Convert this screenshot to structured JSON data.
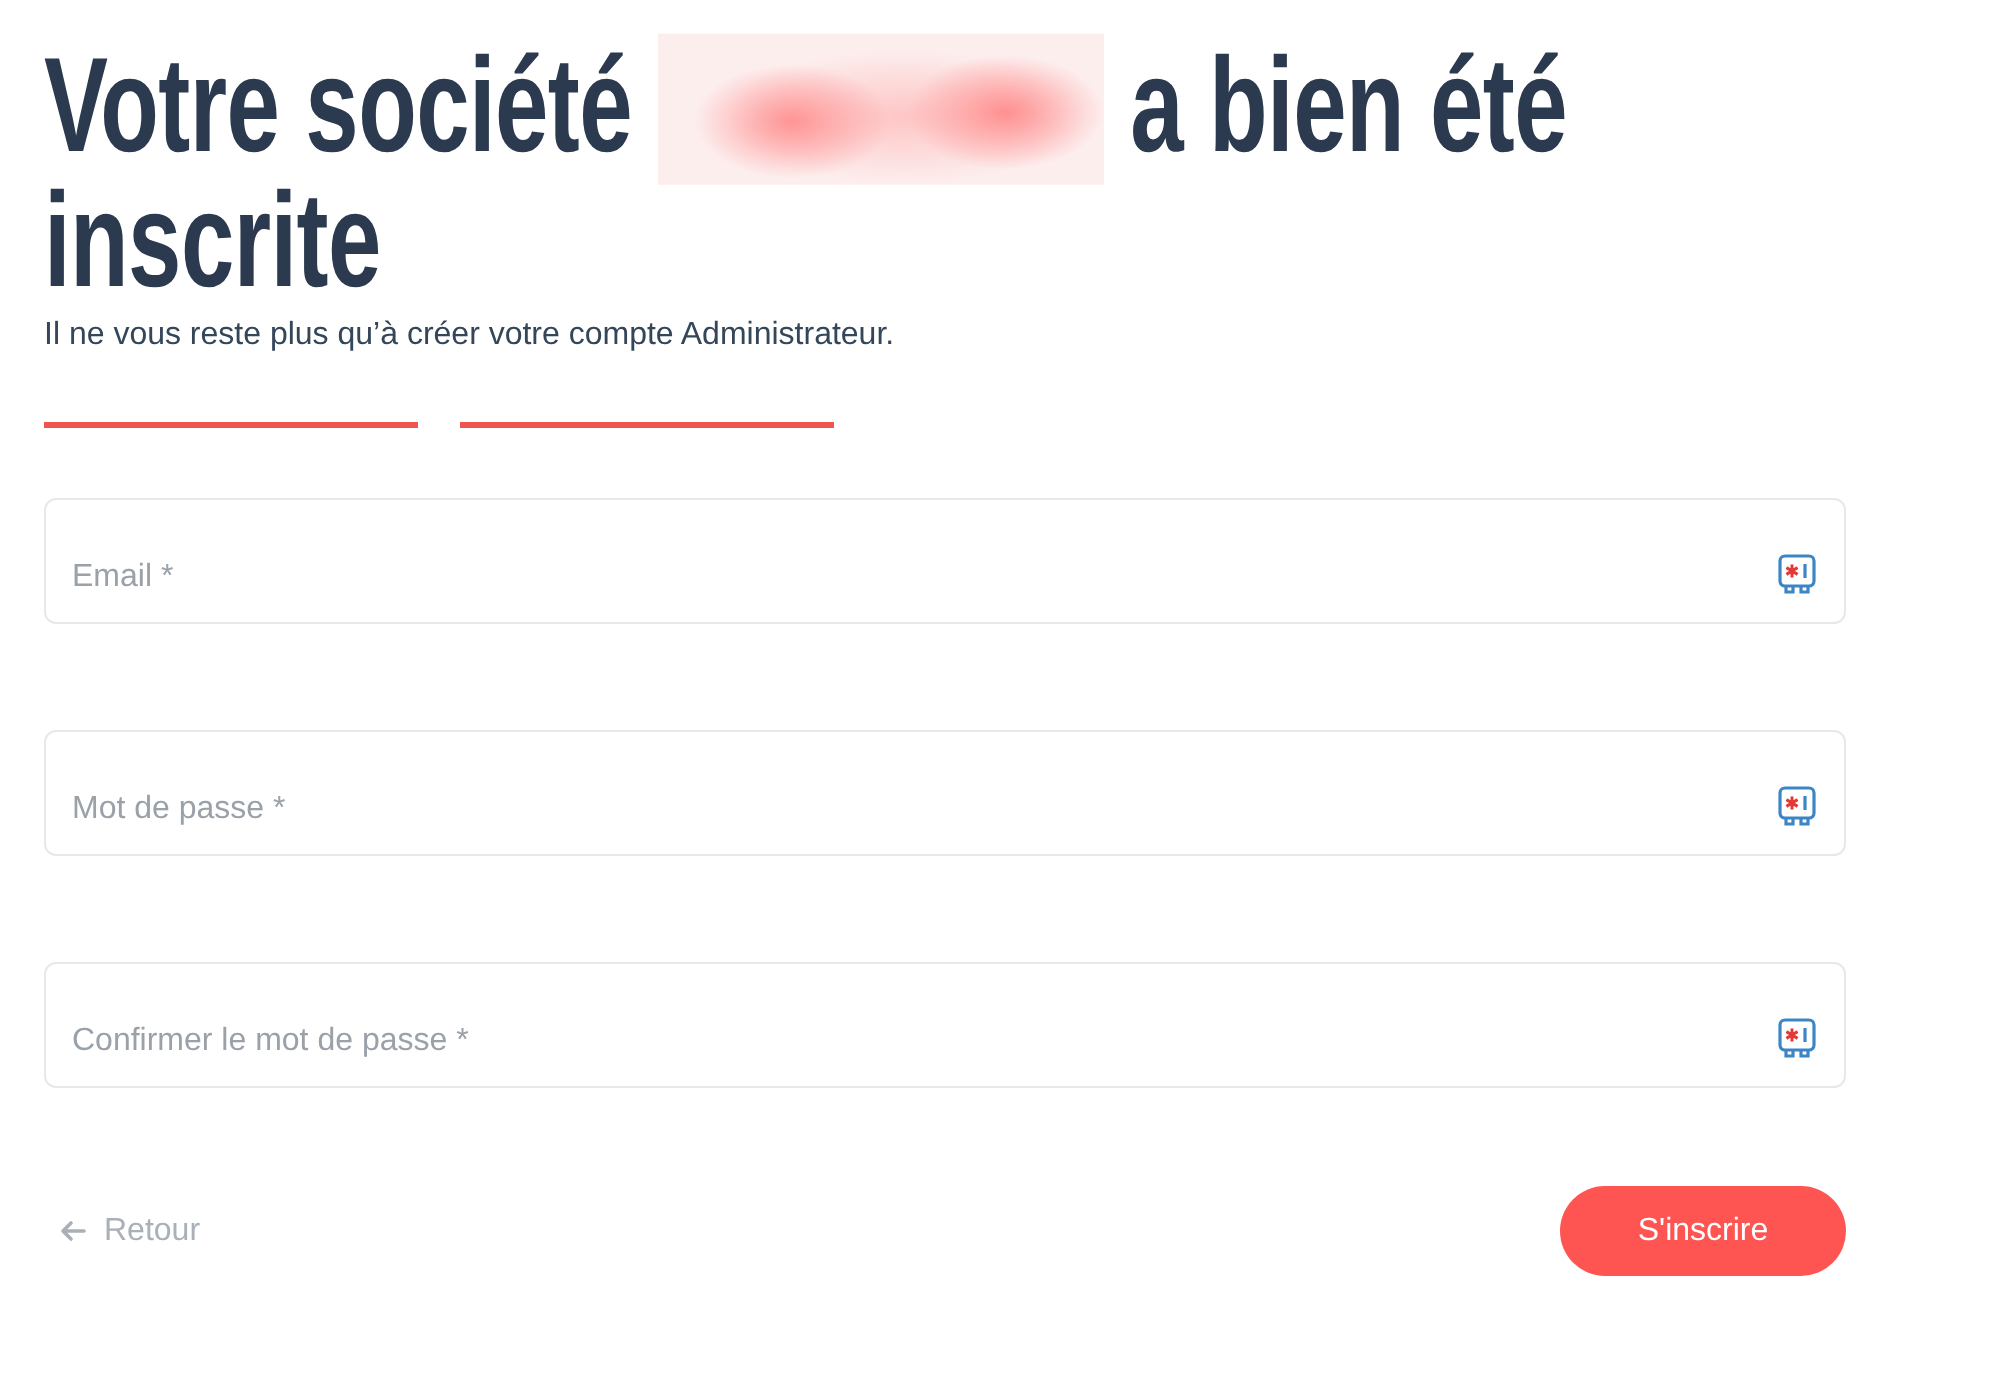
{
  "heading": {
    "before": "Votre société",
    "after": "a bien été",
    "second_line": "inscrite"
  },
  "subtitle": "Il ne vous reste plus qu’à créer votre compte Administrateur.",
  "steps": [
    {
      "done": true
    },
    {
      "done": true
    }
  ],
  "fields": [
    {
      "placeholder": "Email *"
    },
    {
      "placeholder": "Mot de passe *"
    },
    {
      "placeholder": "Confirmer le mot de passe *"
    }
  ],
  "back_link": {
    "label": "Retour"
  },
  "submit": {
    "label": "S'inscrire"
  }
}
